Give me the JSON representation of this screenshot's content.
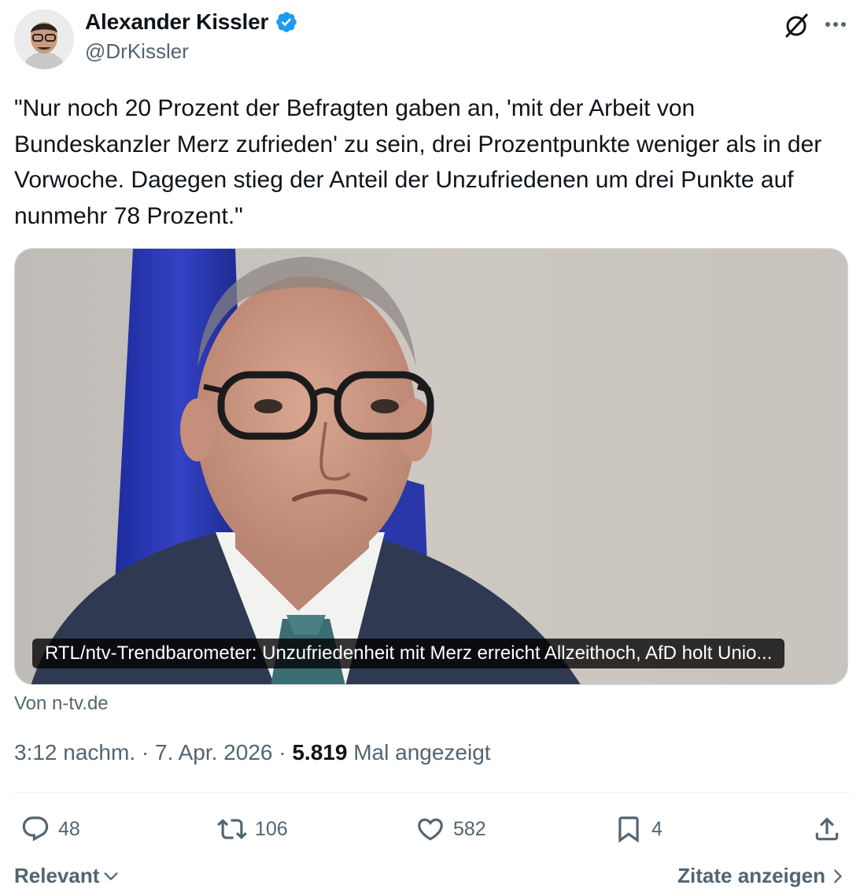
{
  "author": {
    "display_name": "Alexander Kissler",
    "handle": "@DrKissler",
    "verified": true
  },
  "header_icons": [
    "grok-icon",
    "more-icon"
  ],
  "tweet": {
    "text": "\"Nur noch 20 Prozent der Befragten gaben an, 'mit der Arbeit von Bundeskanzler Merz zufrieden' zu sein, drei Prozentpunkte weniger als in der Vorwoche. Dagegen stieg der Anteil der Unzufriedenen um drei Punkte auf nunmehr 78 Prozent.\""
  },
  "link_card": {
    "headline": "RTL/ntv-Trendbarometer: Unzufriedenheit mit Merz erreicht Allzeithoch, AfD holt Unio...",
    "source": "Von n-tv.de"
  },
  "meta": {
    "time": "3:12 nachm.",
    "separator": "·",
    "date": "7. Apr. 2026",
    "views_count": "5.819",
    "views_label": "Mal angezeigt"
  },
  "actions": {
    "replies": "48",
    "retweets": "106",
    "likes": "582",
    "bookmarks": "4"
  },
  "footer": {
    "sort_label": "Relevant",
    "quotes_label": "Zitate anzeigen"
  },
  "colors": {
    "text": "#0f1419",
    "secondary": "#536471",
    "verified": "#1d9bf0",
    "border": "#cfd9de"
  }
}
